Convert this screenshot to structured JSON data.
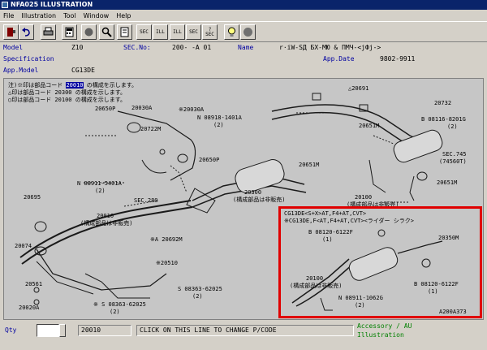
{
  "window": {
    "title": "NFA025 ILLUSTRATION"
  },
  "menu": [
    "File",
    "Illustration",
    "Tool",
    "Window",
    "Help"
  ],
  "toolbar": {
    "buttons": [
      {
        "name": "exit",
        "icon": "door-icon",
        "label": ""
      },
      {
        "name": "back",
        "icon": "undo-icon",
        "label": ""
      },
      {
        "name": "print",
        "icon": "printer-icon",
        "label": ""
      },
      {
        "name": "calculator",
        "icon": "calculator-icon",
        "label": ""
      },
      {
        "name": "search",
        "icon": "magnifier-icon",
        "label": ""
      },
      {
        "name": "zoom",
        "icon": "zoom-icon",
        "label": ""
      },
      {
        "name": "book",
        "icon": "book-icon",
        "label": ""
      },
      {
        "name": "sec-prev",
        "icon": "sec-icon",
        "label": "SEC"
      },
      {
        "name": "ill-prev",
        "icon": "ill-icon",
        "label": "ILL"
      },
      {
        "name": "ill-next",
        "icon": "ill-icon",
        "label": "ILL"
      },
      {
        "name": "sec-next",
        "icon": "sec-icon",
        "label": "SEC"
      },
      {
        "name": "sec-help",
        "icon": "sec-question-icon",
        "label": "? SEC"
      },
      {
        "name": "hint",
        "icon": "lightbulb-icon",
        "label": ""
      },
      {
        "name": "stop",
        "icon": "circle-icon",
        "label": ""
      }
    ]
  },
  "info": {
    "model_label": "Model",
    "model_value": "Z10",
    "secno_label": "SEC.No:",
    "secno_value": "200-  -A 01",
    "name_label": "Name",
    "name_value": "r·iW-SД БХ-МЮ & ПМЧ-<jФj->",
    "spec_label": "Specification",
    "appdate_label": "App.Date",
    "appdate_value": "9802-9911",
    "appmodel_label": "App.Model",
    "appmodel_value": "CG13DE"
  },
  "diagram": {
    "notes": [
      "注)※印は部品コード 20010 の構成を示します。",
      "  △印は部品コード 20300 の構成を示します。",
      "  ○印は部品コード 20100 の構成を示します。"
    ],
    "highlight_code": "20010",
    "callouts": [
      "20650P",
      "20030A",
      "※20030A",
      "20722M",
      "N 08918-1401A",
      "(2)",
      "20650P",
      "N 08911-5401A",
      "(2)",
      "SEC.280",
      "20695",
      "20010",
      "(構成部品は非販売)",
      "※A 20692M",
      "20074",
      "※20510",
      "20561",
      "20020A",
      "※ S 08363-62025",
      "(2)",
      "S 08363-62025",
      "(2)",
      "20300",
      "(構成部品は非販売)",
      "△20691",
      "20732",
      "20651M",
      "B 08116-8201G",
      "(2)",
      "SEC.745",
      "(74560T)",
      "20651M",
      "20651M",
      "20100",
      "(構成部品は非販売)"
    ],
    "inset": {
      "header1": "CG13DE<S+X>AT,F4+AT,CVT>",
      "header2": "※CG13DE,F<AT,F4+AT,CVT><ライダー シラク>",
      "callouts": [
        "B 08120-6122F",
        "(1)",
        "20350M",
        "20100",
        "(構成部品は非販売)",
        "B 08120-6122F",
        "(1)",
        "N 08911-1062G",
        "(2)"
      ],
      "figure_code": "A200A373"
    }
  },
  "status": {
    "qty_label": "Qty",
    "qty_value": "",
    "part_code": "20010",
    "message": "CLICK ON THIS LINE TO CHANGE P/CODE",
    "accessory_line1": "Accessory / AU",
    "accessory_line2": "Illustration"
  },
  "colors": {
    "title_bar": "#0a246a",
    "label_blue": "#0000a0",
    "highlight_red": "#e00000",
    "diagram_bg": "#c6c6c6",
    "accessory_green": "#008000"
  }
}
